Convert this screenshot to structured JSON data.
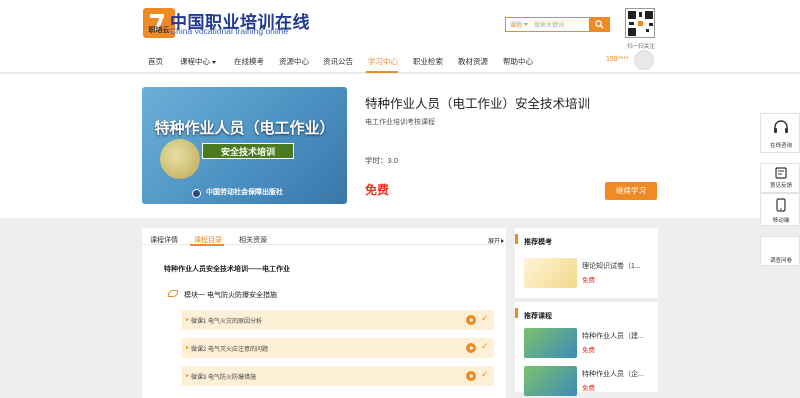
{
  "header": {
    "logo_sub": "职培云",
    "title": "中国职业培训在线",
    "subtitle": "China vocational training online",
    "search": {
      "category": "课程",
      "placeholder": "搜索关键词"
    },
    "qr_label": "扫一扫关注",
    "user_phone": "159****"
  },
  "nav": [
    "首页",
    "课程中心",
    "在线模考",
    "资源中心",
    "资讯公告",
    "学习中心",
    "职业检索",
    "教材资源",
    "帮助中心"
  ],
  "course": {
    "cover_title": "特种作业人员（电工作业）",
    "cover_sub": "安全技术培训",
    "cover_pub": "中国劳动社会保障出版社",
    "title": "特种作业人员（电工作业）安全技术培训",
    "subtitle": "电工作业培训考核课程",
    "hours": "学时：3.0",
    "price": "免费",
    "continue": "继续学习"
  },
  "tabs": {
    "items": [
      "课程详情",
      "课程目录",
      "相关资源"
    ],
    "expand": "展开"
  },
  "catalog": {
    "chapter": "特种作业人员安全技术培训——电工作业",
    "module": "模块一 电气防火防爆安全措施",
    "lessons": [
      "微课1 电气火灾的原因分析",
      "微课2 电气灭火应注意的问题",
      "微课3 电气防火防爆措施"
    ]
  },
  "recommend_exam": {
    "title": "推荐模考",
    "items": [
      {
        "name": "理论知识试卷（1...",
        "price": "免费"
      }
    ]
  },
  "recommend_course": {
    "title": "推荐课程",
    "items": [
      {
        "name": "特种作业人员（建...",
        "price": "免费"
      },
      {
        "name": "特种作业人员（企...",
        "price": "免费"
      }
    ]
  },
  "float_bar": [
    "在线咨询",
    "意见反馈",
    "移动端",
    "调查问卷"
  ],
  "colors": {
    "accent": "#f08a24",
    "price": "#e8361e",
    "brand": "#1f3a93"
  }
}
